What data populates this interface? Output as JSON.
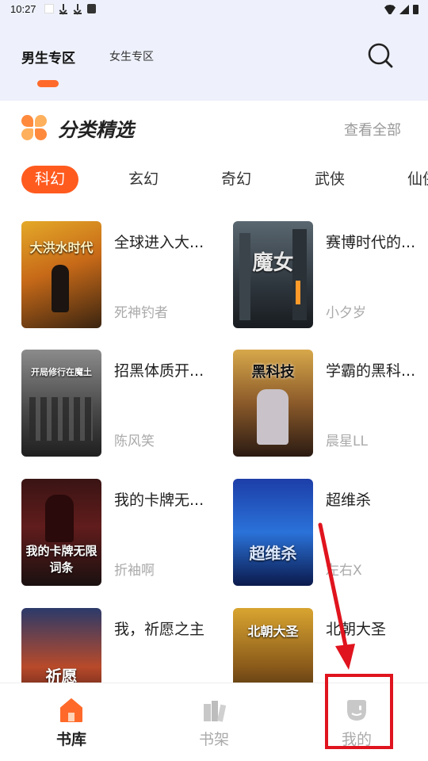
{
  "status_bar": {
    "time": "10:27"
  },
  "header": {
    "tabs": [
      {
        "label": "男生专区",
        "active": true
      },
      {
        "label": "女生专区",
        "active": false
      }
    ],
    "accent_color": "#ff6a2a"
  },
  "section": {
    "title": "分类精选",
    "view_all": "查看全部"
  },
  "categories": [
    {
      "label": "科幻",
      "active": true
    },
    {
      "label": "玄幻",
      "active": false
    },
    {
      "label": "奇幻",
      "active": false
    },
    {
      "label": "武侠",
      "active": false
    },
    {
      "label": "仙侠",
      "active": false
    }
  ],
  "books": [
    {
      "title": "全球进入大...",
      "author": "死神钓者",
      "cover_text": "大洪水时代"
    },
    {
      "title": "赛博时代的...",
      "author": "小夕岁",
      "cover_text": "魔女"
    },
    {
      "title": "招黑体质开...",
      "author": "陈风笑",
      "cover_text": "开局修行在魔土"
    },
    {
      "title": "学霸的黑科...",
      "author": "晨星LL",
      "cover_text": "黑科技"
    },
    {
      "title": "我的卡牌无...",
      "author": "折袖啊",
      "cover_text": "我的卡牌无限词条"
    },
    {
      "title": "超维杀",
      "author": "左右X",
      "cover_text": "超维杀"
    },
    {
      "title": "我，祈愿之主",
      "author": "",
      "cover_text": "祈愿"
    },
    {
      "title": "北朝大圣",
      "author": "",
      "cover_text": "北朝大圣"
    }
  ],
  "bottom_nav": [
    {
      "label": "书库",
      "icon": "home-icon",
      "active": true
    },
    {
      "label": "书架",
      "icon": "bookshelf-icon",
      "active": false
    },
    {
      "label": "我的",
      "icon": "profile-icon",
      "active": false
    }
  ],
  "annotation": {
    "color": "#e0141e",
    "target": "我的"
  }
}
